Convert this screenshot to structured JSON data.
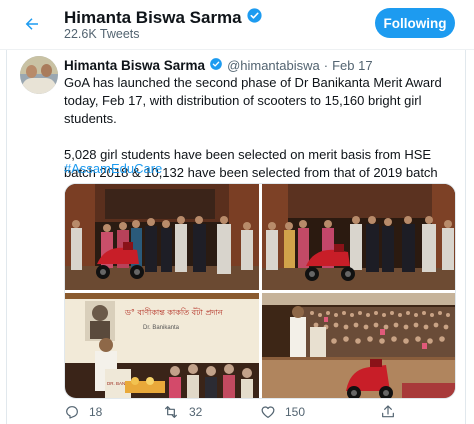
{
  "header": {
    "back_icon": "arrow-left-icon",
    "name": "Himanta Biswa Sarma",
    "verified_icon": "verified-badge-icon",
    "tweet_count": "22.6K Tweets",
    "follow_label": "Following"
  },
  "tweet": {
    "author_name": "Himanta Biswa Sarma",
    "handle": "@himantabiswa",
    "separator": "·",
    "date": "Feb 17",
    "body_line1": "GoA has launched the second phase of Dr Banikanta Merit Award today, Feb 17, with distribution of scooters to 15,160 bright girl students.",
    "body_line2": "5,028 girl students have been selected on merit basis from HSE batch 2018 & 10,132 have been selected from that of 2019 batch",
    "hashtag": "#AssamEduCare",
    "banner_text_line1": "ড° বাণীকান্ত কাকতি বঁটা প্ৰদান",
    "banner_text_line2": "Dr. Banikanta",
    "lectern_text": "DR. BANIKANTA"
  },
  "actions": {
    "reply_icon": "reply-icon",
    "reply_count": "18",
    "retweet_icon": "retweet-icon",
    "retweet_count": "32",
    "like_icon": "heart-icon",
    "like_count": "150",
    "share_icon": "share-icon"
  },
  "colors": {
    "accent": "#1d9bf0",
    "text": "#0f1419",
    "muted": "#536471",
    "scooter_red": "#c81e28"
  }
}
